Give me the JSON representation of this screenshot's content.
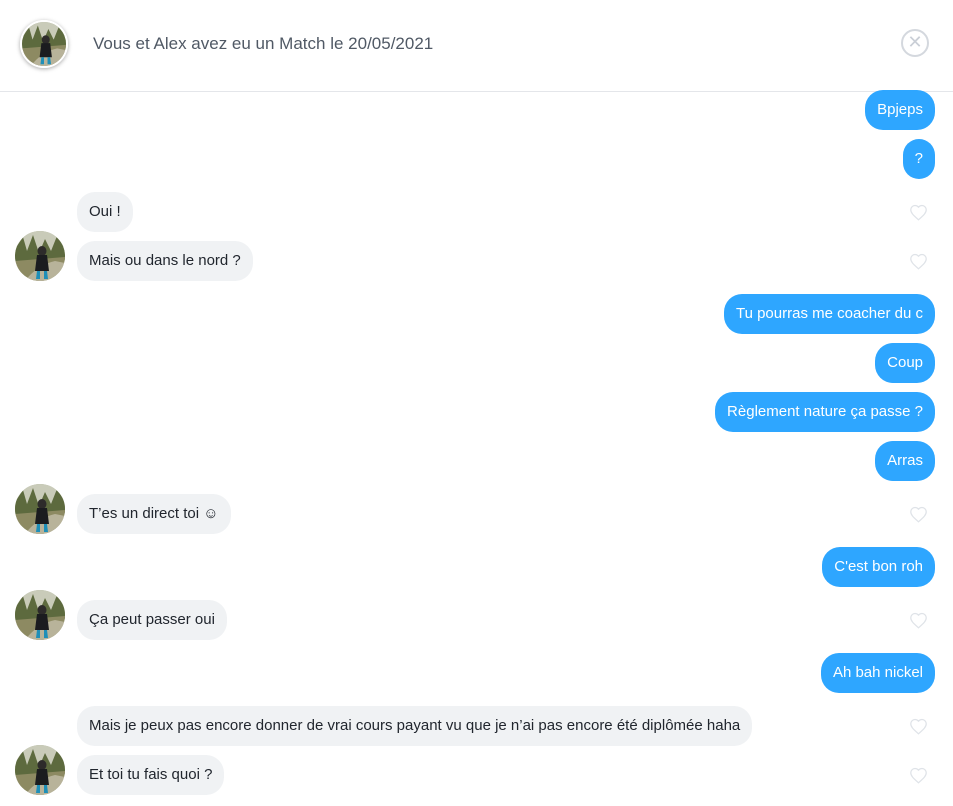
{
  "header": {
    "title": "Vous et Alex avez eu un Match le 20/05/2021",
    "close_icon": "✕"
  },
  "messages": [
    {
      "from": "me",
      "text": "Bpjeps"
    },
    {
      "from": "me",
      "text": "?"
    },
    {
      "from": "them",
      "text": "Oui !"
    },
    {
      "from": "them",
      "text": "Mais ou dans le nord ?"
    },
    {
      "from": "me",
      "text": "Tu pourras me coacher du c"
    },
    {
      "from": "me",
      "text": "Coup"
    },
    {
      "from": "me",
      "text": "Règlement nature ça passe ?"
    },
    {
      "from": "me",
      "text": "Arras"
    },
    {
      "from": "them",
      "text": "T’es un direct toi ☺"
    },
    {
      "from": "me",
      "text": "C'est bon roh"
    },
    {
      "from": "them",
      "text": "Ça peut passer oui"
    },
    {
      "from": "me",
      "text": "Ah bah nickel"
    },
    {
      "from": "them",
      "text": "Mais je peux pas encore donner de vrai cours payant vu que je n’ai pas encore été diplômée haha"
    },
    {
      "from": "them",
      "text": "Et toi tu fais quoi ?"
    }
  ],
  "colors": {
    "outgoing": "#2ea6ff",
    "incoming": "#f0f2f4",
    "header_text": "#505965"
  },
  "icons": {
    "like": "heart-icon",
    "close": "close-icon",
    "avatar": "profile-photo"
  }
}
